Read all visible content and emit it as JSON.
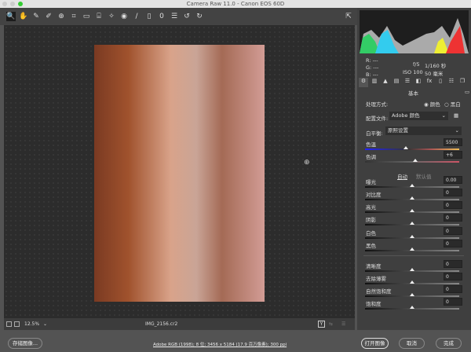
{
  "window": {
    "title": "Camera Raw 11.0  -  Canon EOS 60D"
  },
  "toolbar": {
    "tools": [
      "zoom-tool",
      "hand-tool",
      "white-balance-tool",
      "color-sampler-tool",
      "targeted-adjustment-tool",
      "crop-tool",
      "straighten-tool",
      "transform-tool",
      "spot-removal-tool",
      "red-eye-tool",
      "adjustment-brush",
      "graduated-filter",
      "radial-filter",
      "presets",
      "rotate-ccw",
      "rotate-cw"
    ],
    "icons": [
      "🔍",
      "✋",
      "✎",
      "✐",
      "⊕",
      "⌗",
      "▭",
      "⌸",
      "✧",
      "◉",
      "/",
      "▯",
      "0",
      "☰",
      "↺",
      "↻"
    ]
  },
  "info": {
    "r": "R:  ---",
    "g": "G:  ---",
    "b": "B:  ---",
    "aperture": "f/5",
    "shutter": "1/160 秒",
    "iso": "ISO 100",
    "focal": "50 毫米"
  },
  "panel": {
    "title": "基本",
    "process_label": "处理方式:",
    "process_color": "颜色",
    "process_bw": "黑白",
    "profile_label": "配置文件:",
    "profile_value": "Adobe 颜色",
    "wb_label": "白平衡:",
    "wb_value": "原照设置",
    "auto": "自动",
    "default": "默认值",
    "sliders": [
      {
        "label": "色温",
        "value": "5500",
        "pos": 0.43
      },
      {
        "label": "色调",
        "value": "+6",
        "pos": 0.53
      },
      {
        "label": "曝光",
        "value": "0.00",
        "pos": 0.5
      },
      {
        "label": "对比度",
        "value": "0",
        "pos": 0.5
      },
      {
        "label": "高光",
        "value": "0",
        "pos": 0.5
      },
      {
        "label": "阴影",
        "value": "0",
        "pos": 0.5
      },
      {
        "label": "白色",
        "value": "0",
        "pos": 0.5
      },
      {
        "label": "黑色",
        "value": "0",
        "pos": 0.5
      },
      {
        "label": "清晰度",
        "value": "0",
        "pos": 0.5
      },
      {
        "label": "去除薄雾",
        "value": "0",
        "pos": 0.5
      },
      {
        "label": "自然饱和度",
        "value": "0",
        "pos": 0.5
      },
      {
        "label": "饱和度",
        "value": "0",
        "pos": 0.5
      }
    ]
  },
  "status": {
    "zoom": "12.5%",
    "filename": "IMG_2156.cr2",
    "y_toggle": "Y"
  },
  "footer": {
    "save": "存储图像...",
    "workflow": "Adobe RGB (1998); 8 位; 3456 x 5184 (17.9 百万像素); 300 ppi",
    "open": "打开图像",
    "cancel": "取消",
    "done": "完成"
  }
}
